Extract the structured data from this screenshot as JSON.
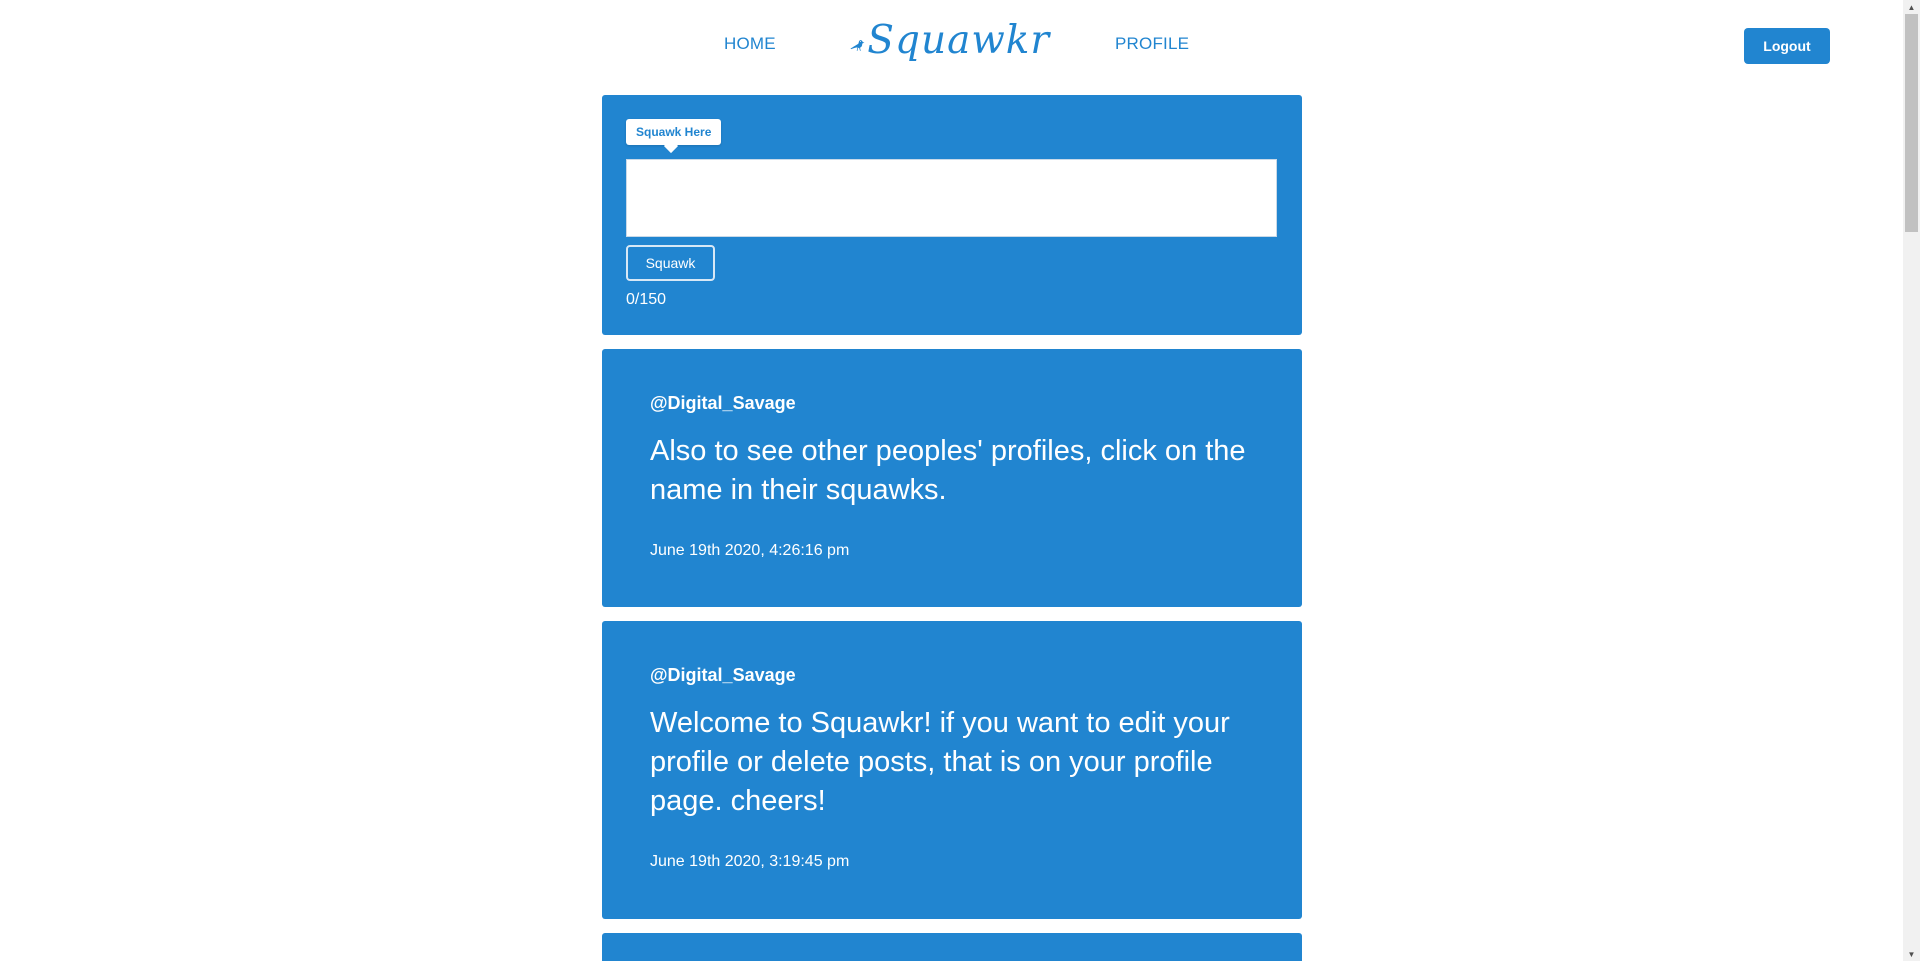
{
  "nav": {
    "home_label": "HOME",
    "brand_name": "Squawkr",
    "brand_icon": "crow-icon",
    "profile_label": "PROFILE",
    "logout_label": "Logout"
  },
  "compose": {
    "tooltip": "Squawk Here",
    "input_value": "",
    "button_label": "Squawk",
    "char_count": "0/150"
  },
  "posts": [
    {
      "author": "@Digital_Savage",
      "body": "Also to see other peoples' profiles, click on the name in their squawks.",
      "timestamp": "June 19th 2020, 4:26:16 pm"
    },
    {
      "author": "@Digital_Savage",
      "body": "Welcome to Squawkr! if you want to edit your profile or delete posts, that is on your profile page. cheers!",
      "timestamp": "June 19th 2020, 3:19:45 pm"
    }
  ],
  "colors": {
    "primary": "#2185d0",
    "background": "#ffffff",
    "text_on_primary": "#ffffff"
  }
}
